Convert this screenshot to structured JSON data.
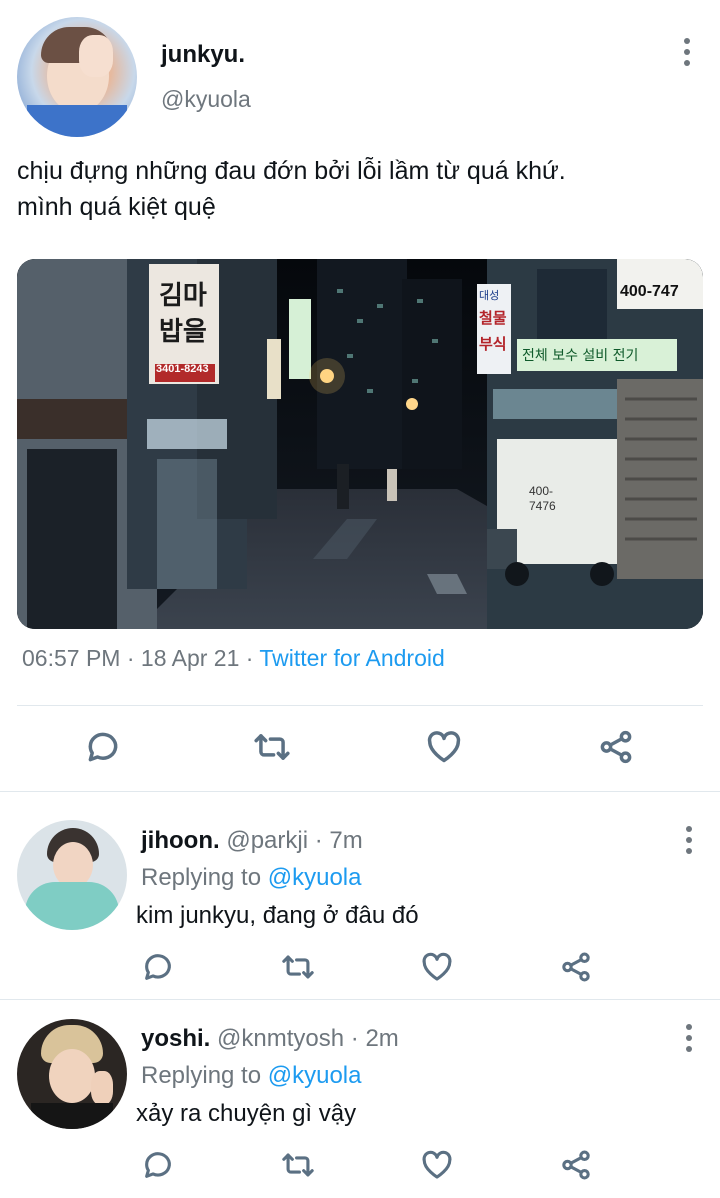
{
  "tweet": {
    "display_name": "junkyu.",
    "handle": "@kyuola",
    "text_line1": "chịu đựng những đau đớn bởi lỗi lầm từ quá khứ.",
    "text_line2": "mình quá kiệt quệ",
    "time": "06:57 PM",
    "date": "18 Apr 21",
    "source": "Twitter for Android",
    "image_signs": [
      "김마",
      "밥을",
      "3401-8243",
      "대성",
      "철물",
      "부식",
      "400-747",
      "전체 보수 설비 전기",
      "400-",
      "7476"
    ]
  },
  "replies": [
    {
      "display_name": "jihoon.",
      "handle": "@parkji",
      "time": "7m",
      "replying_label": "Replying to",
      "replying_to": "@kyuola",
      "text": "kim junkyu, đang ở đâu đó"
    },
    {
      "display_name": "yoshi.",
      "handle": "@knmtyosh",
      "time": "2m",
      "replying_label": "Replying to",
      "replying_to": "@kyuola",
      "text": "xảy ra chuyện gì vậy"
    }
  ],
  "icons": [
    "reply-icon",
    "retweet-icon",
    "like-icon",
    "share-icon",
    "more-icon"
  ],
  "colors": {
    "accent": "#1d9bf0",
    "muted": "#6e767d",
    "icon": "#5b7083",
    "divider": "#e1e8ed"
  }
}
